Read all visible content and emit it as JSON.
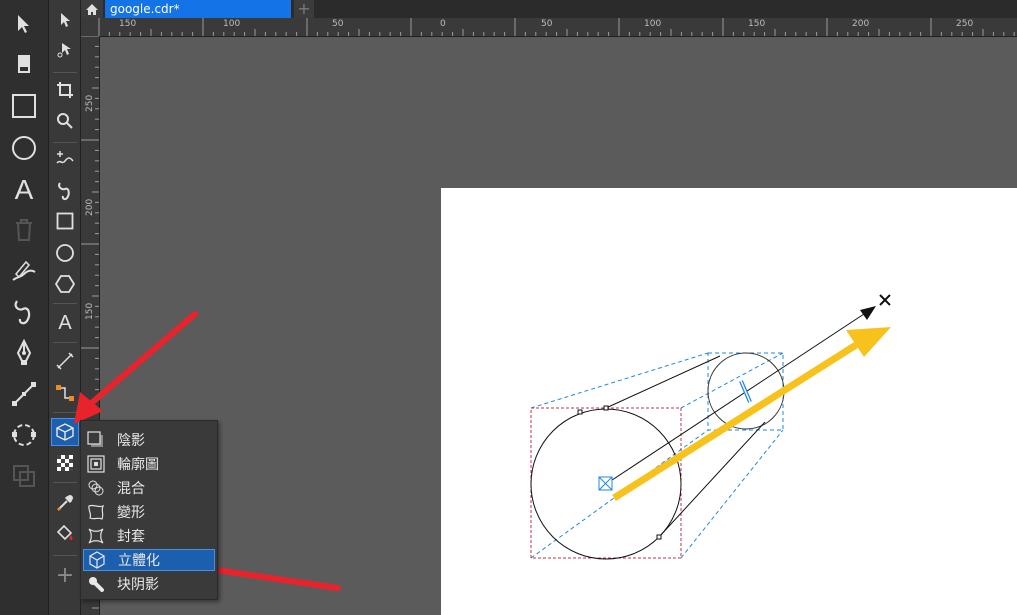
{
  "tabs": {
    "document_name": "google.cdr*",
    "add_label": "+"
  },
  "ruler": {
    "horizontal_ticks": [
      "150",
      "100",
      "50",
      "0",
      "50",
      "100",
      "150",
      "200",
      "250"
    ],
    "vertical_ticks": [
      "250",
      "200",
      "150"
    ]
  },
  "toolbar_left": {
    "items": [
      "pointer-icon",
      "eraser-icon",
      "rectangle-icon",
      "ellipse-icon",
      "text-icon",
      "trash-icon",
      "artistic-media-icon",
      "curve-icon",
      "pen-icon",
      "connector-icon",
      "node-icon",
      "transparency-icon"
    ],
    "text_tool_label": "A"
  },
  "toolbar_main": {
    "text_tool_label": "A",
    "add_tool_label": "+"
  },
  "flyout": {
    "items": [
      {
        "label": "陰影",
        "icon": "drop-shadow-icon",
        "selected": false
      },
      {
        "label": "輪廓圖",
        "icon": "contour-icon",
        "selected": false
      },
      {
        "label": "混合",
        "icon": "blend-icon",
        "selected": false
      },
      {
        "label": "變形",
        "icon": "distort-icon",
        "selected": false
      },
      {
        "label": "封套",
        "icon": "envelope-icon",
        "selected": false
      },
      {
        "label": "立體化",
        "icon": "extrude-icon",
        "selected": true
      },
      {
        "label": "块阴影",
        "icon": "block-shadow-icon",
        "selected": false
      }
    ]
  },
  "colors": {
    "accent": "#1473e6",
    "annotation_arrow": "#e8232c",
    "drag_arrow": "#f8c21c",
    "selection_outline": "#c0304a",
    "extrude_guides": "#1e88e5"
  }
}
